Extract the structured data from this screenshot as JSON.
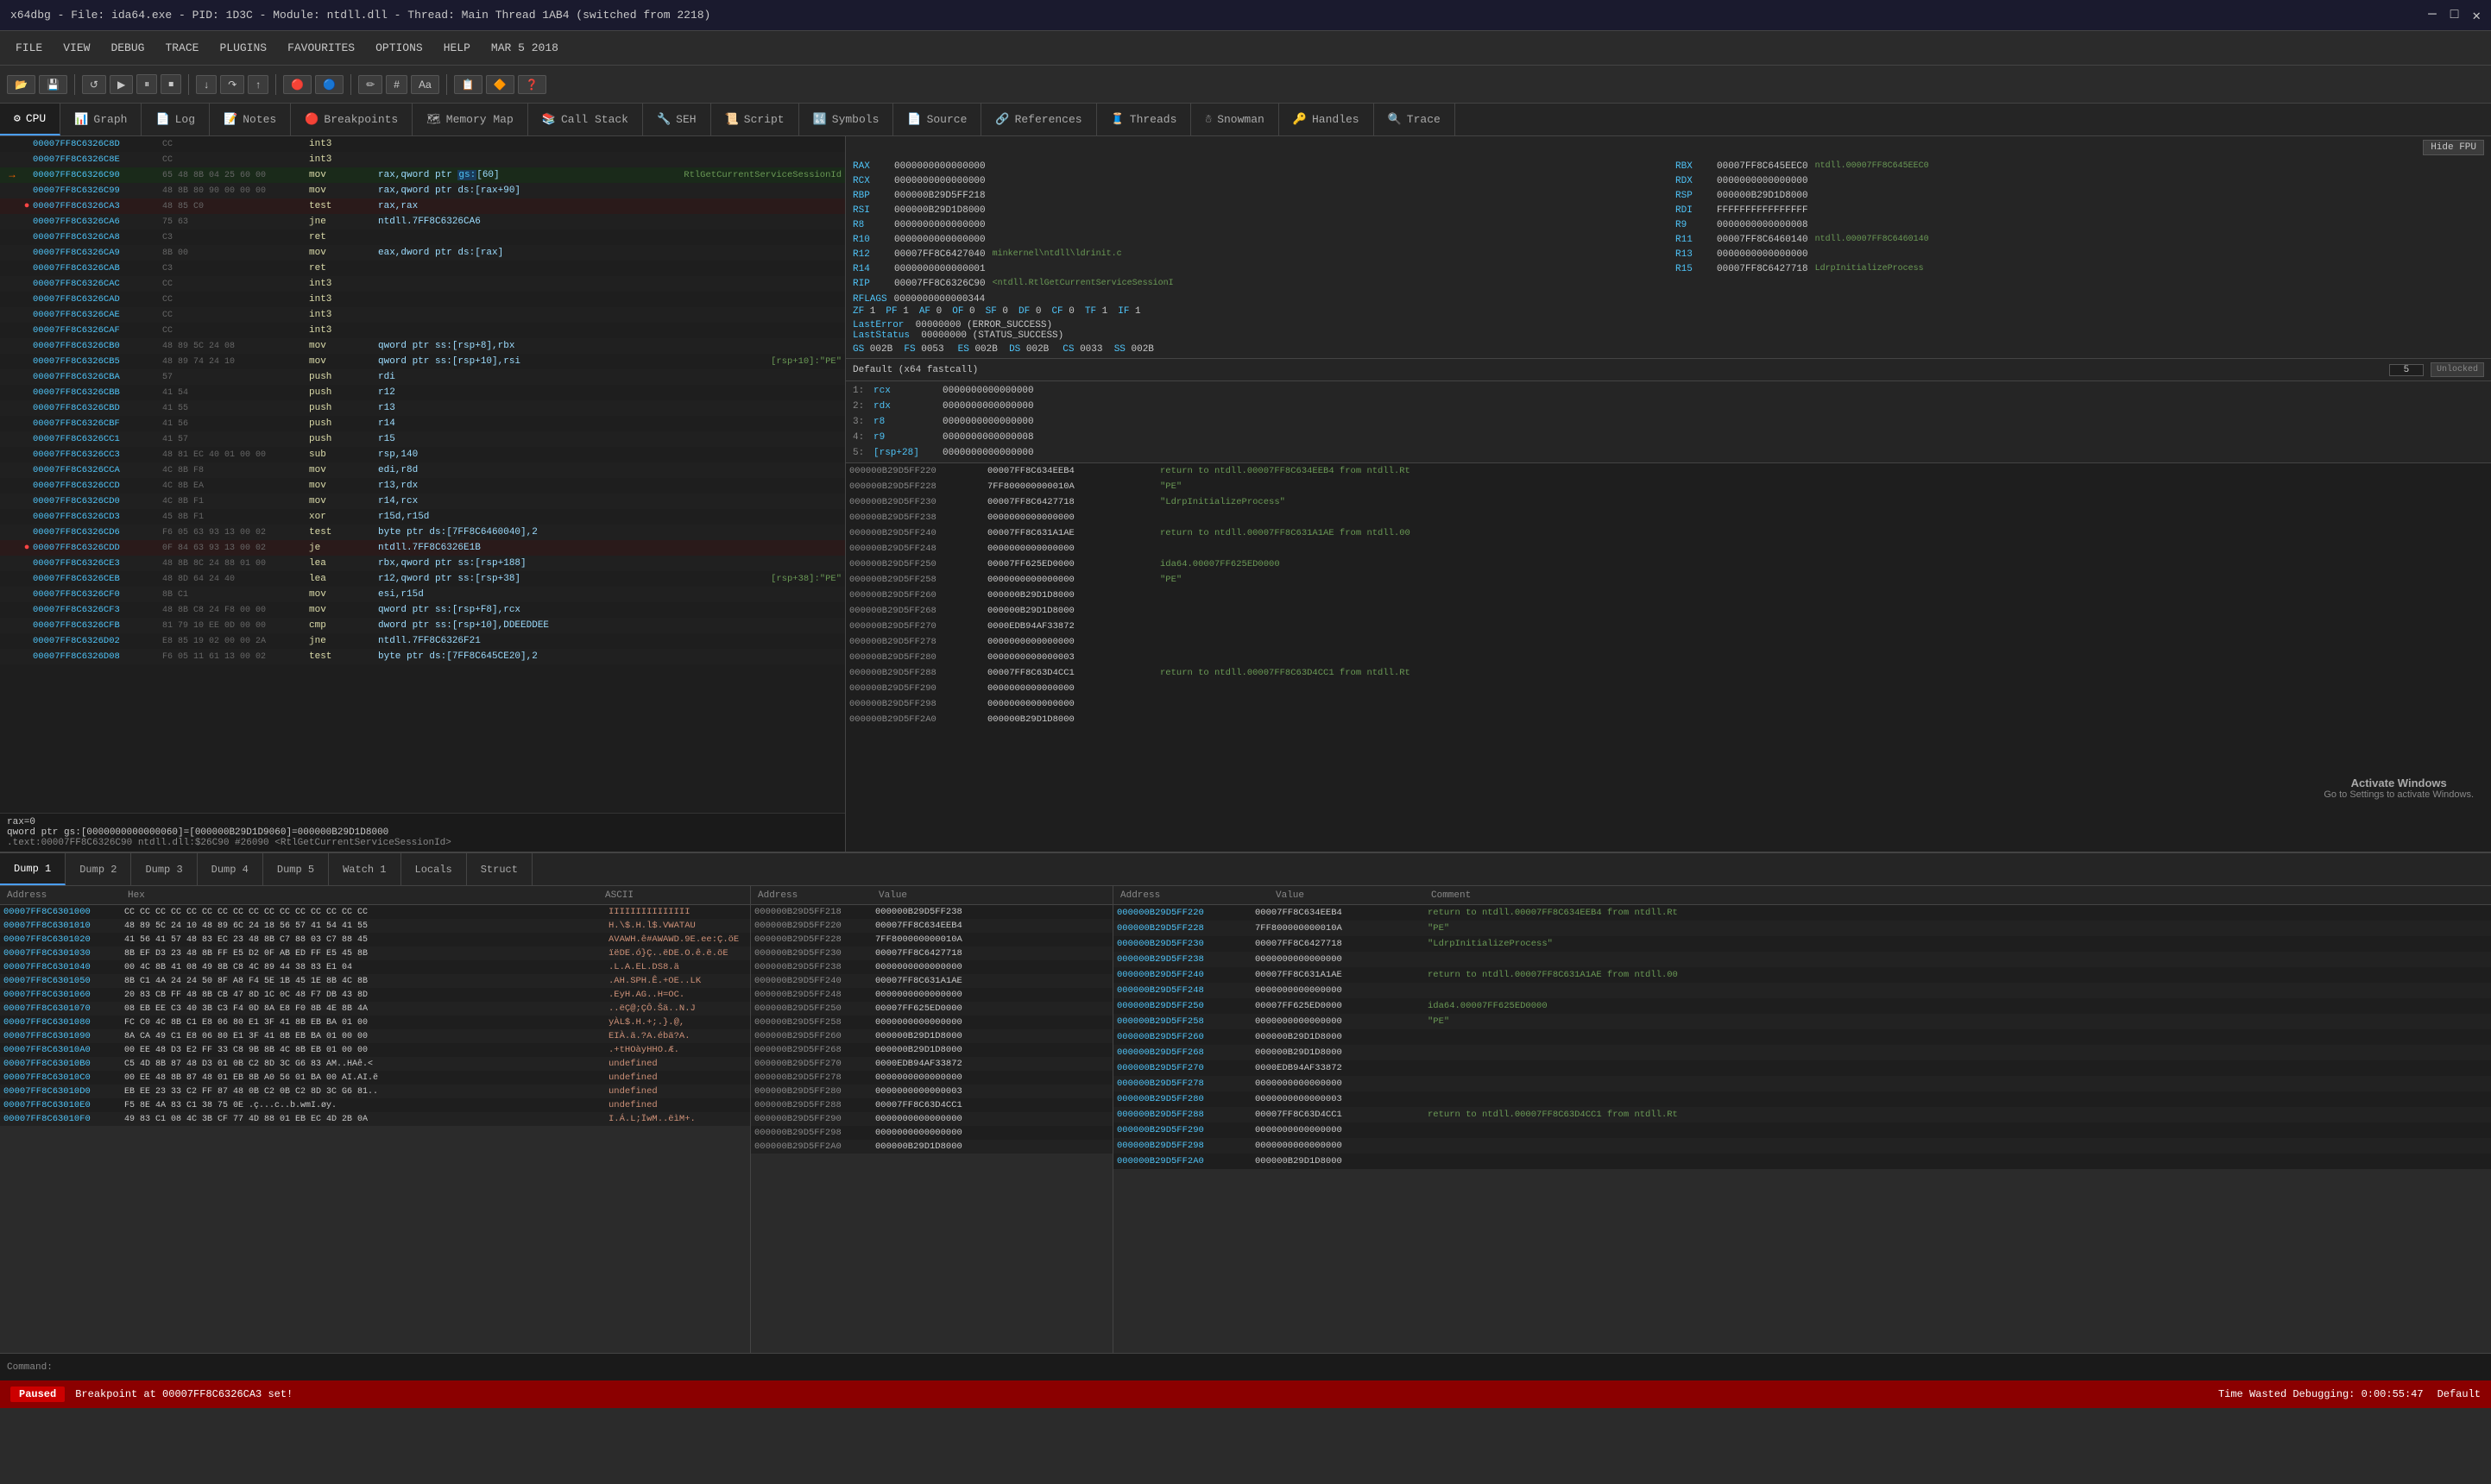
{
  "titleBar": {
    "text": "x64dbg - File: ida64.exe - PID: 1D3C - Module: ntdll.dll - Thread: Main Thread 1AB4 (switched from 2218)"
  },
  "menuBar": {
    "items": [
      "FILE",
      "VIEW",
      "DEBUG",
      "TRACE",
      "PLUGINS",
      "FAVOURITES",
      "OPTIONS",
      "HELP",
      "MAR 5 2018"
    ]
  },
  "tabs": {
    "items": [
      {
        "label": "CPU",
        "active": true
      },
      {
        "label": "Graph"
      },
      {
        "label": "Log"
      },
      {
        "label": "Notes"
      },
      {
        "label": "Breakpoints"
      },
      {
        "label": "Memory Map"
      },
      {
        "label": "Call Stack"
      },
      {
        "label": "SEH"
      },
      {
        "label": "Script"
      },
      {
        "label": "Symbols"
      },
      {
        "label": "Source"
      },
      {
        "label": "References"
      },
      {
        "label": "Threads"
      },
      {
        "label": "Snowman"
      },
      {
        "label": "Handles"
      },
      {
        "label": "Trace"
      }
    ]
  },
  "disasm": {
    "rows": [
      {
        "addr": "00007FF8C6326C8D",
        "bp": "",
        "rip": false,
        "bytes": "CC",
        "instr": "int3",
        "operands": "",
        "comment": ""
      },
      {
        "addr": "00007FF8C6326C8E",
        "bp": "",
        "rip": false,
        "bytes": "CC",
        "instr": "int3",
        "operands": "",
        "comment": ""
      },
      {
        "addr": "00007FF8C6326C90",
        "bp": "",
        "rip": true,
        "bytes": "65 48 8B 04 25 60 00",
        "instr": "mov",
        "operands": "rax,qword ptr gs:[60]",
        "comment": "RtlGetCurrentServiceSessionId"
      },
      {
        "addr": "00007FF8C6326C99",
        "bp": "",
        "rip": false,
        "bytes": "48 8B 80 90 00 00 00",
        "instr": "mov",
        "operands": "rax,qword ptr ds:[rax+90]",
        "comment": ""
      },
      {
        "addr": "00007FF8C6326CA3",
        "bp": "●",
        "rip": false,
        "bytes": "48 85 C0",
        "instr": "test",
        "operands": "rax,rax",
        "comment": ""
      },
      {
        "addr": "00007FF8C6326CA6",
        "bp": "",
        "rip": false,
        "bytes": "75 63",
        "instr": "jne",
        "operands": "ntdll.7FF8C6326CA6",
        "comment": ""
      },
      {
        "addr": "00007FF8C6326CA8",
        "bp": "",
        "rip": false,
        "bytes": "C3",
        "instr": "ret",
        "operands": "",
        "comment": ""
      },
      {
        "addr": "00007FF8C6326CA9",
        "bp": "",
        "rip": false,
        "bytes": "8B 00",
        "instr": "mov",
        "operands": "eax,dword ptr ds:[rax]",
        "comment": ""
      },
      {
        "addr": "00007FF8C6326CAB",
        "bp": "",
        "rip": false,
        "bytes": "C3",
        "instr": "ret",
        "operands": "",
        "comment": ""
      },
      {
        "addr": "00007FF8C6326CAC",
        "bp": "",
        "rip": false,
        "bytes": "CC",
        "instr": "int3",
        "operands": "",
        "comment": ""
      },
      {
        "addr": "00007FF8C6326CAD",
        "bp": "",
        "rip": false,
        "bytes": "CC",
        "instr": "int3",
        "operands": "",
        "comment": ""
      },
      {
        "addr": "00007FF8C6326CAE",
        "bp": "",
        "rip": false,
        "bytes": "CC",
        "instr": "int3",
        "operands": "",
        "comment": ""
      },
      {
        "addr": "00007FF8C6326CAF",
        "bp": "",
        "rip": false,
        "bytes": "CC",
        "instr": "int3",
        "operands": "",
        "comment": ""
      },
      {
        "addr": "00007FF8C6326CB0",
        "bp": "",
        "rip": false,
        "bytes": "48 89 5C 24 08",
        "instr": "mov",
        "operands": "qword ptr ss:[rsp+8],rbx",
        "comment": ""
      },
      {
        "addr": "00007FF8C6326CB5",
        "bp": "",
        "rip": false,
        "bytes": "48 89 74 24 10",
        "instr": "mov",
        "operands": "qword ptr ss:[rsp+10],rsi",
        "comment": "[rsp+10]:\"PE\""
      },
      {
        "addr": "00007FF8C6326CBA",
        "bp": "",
        "rip": false,
        "bytes": "57",
        "instr": "push",
        "operands": "rdi",
        "comment": ""
      },
      {
        "addr": "00007FF8C6326CBB",
        "bp": "",
        "rip": false,
        "bytes": "41 54",
        "instr": "push",
        "operands": "r12",
        "comment": ""
      },
      {
        "addr": "00007FF8C6326CBD",
        "bp": "",
        "rip": false,
        "bytes": "41 55",
        "instr": "push",
        "operands": "r13",
        "comment": ""
      },
      {
        "addr": "00007FF8C6326CBF",
        "bp": "",
        "rip": false,
        "bytes": "41 56",
        "instr": "push",
        "operands": "r14",
        "comment": ""
      },
      {
        "addr": "00007FF8C6326CC1",
        "bp": "",
        "rip": false,
        "bytes": "41 57",
        "instr": "push",
        "operands": "r15",
        "comment": ""
      },
      {
        "addr": "00007FF8C6326CC3",
        "bp": "",
        "rip": false,
        "bytes": "48 81 EC 40 01 00 00",
        "instr": "sub",
        "operands": "rsp,140",
        "comment": ""
      },
      {
        "addr": "00007FF8C6326CCA",
        "bp": "",
        "rip": false,
        "bytes": "4C 8B F8",
        "instr": "mov",
        "operands": "edi,r8d",
        "comment": ""
      },
      {
        "addr": "00007FF8C6326CCD",
        "bp": "",
        "rip": false,
        "bytes": "4C 8B EA",
        "instr": "mov",
        "operands": "r13,rdx",
        "comment": ""
      },
      {
        "addr": "00007FF8C6326CD0",
        "bp": "",
        "rip": false,
        "bytes": "4C 8B F1",
        "instr": "mov",
        "operands": "r14,rcx",
        "comment": ""
      },
      {
        "addr": "00007FF8C6326CD3",
        "bp": "",
        "rip": false,
        "bytes": "45 8B F1",
        "instr": "xor",
        "operands": "r15d,r15d",
        "comment": ""
      },
      {
        "addr": "00007FF8C6326CD6",
        "bp": "",
        "rip": false,
        "bytes": "F6 05 63 93 13 00 02",
        "instr": "test",
        "operands": "byte ptr ds:[7FF8C6460040],2",
        "comment": ""
      },
      {
        "addr": "00007FF8C6326CDD",
        "bp": "●",
        "rip": false,
        "bytes": "0F 84 63 93 13 00 02",
        "instr": "je",
        "operands": "ntdll.7FF8C6326E1B",
        "comment": ""
      },
      {
        "addr": "00007FF8C6326CE3",
        "bp": "",
        "rip": false,
        "bytes": "48 8B 8C 24 88 01 00",
        "instr": "lea",
        "operands": "rbx,qword ptr ss:[rsp+188]",
        "comment": ""
      },
      {
        "addr": "00007FF8C6326CEB",
        "bp": "",
        "rip": false,
        "bytes": "48 8D 64 24 40",
        "instr": "lea",
        "operands": "r12,qword ptr ss:[rsp+38]",
        "comment": "[rsp+38]:\"PE\""
      },
      {
        "addr": "00007FF8C6326CF0",
        "bp": "",
        "rip": false,
        "bytes": "8B C1",
        "instr": "mov",
        "operands": "esi,r15d",
        "comment": ""
      },
      {
        "addr": "00007FF8C6326CF3",
        "bp": "",
        "rip": false,
        "bytes": "48 8B C8 24 F8 00 00",
        "instr": "mov",
        "operands": "qword ptr ss:[rsp+F8],rcx",
        "comment": ""
      },
      {
        "addr": "00007FF8C6326CFB",
        "bp": "",
        "rip": false,
        "bytes": "81 79 10 EE 0D 00 00",
        "instr": "cmp",
        "operands": "dword ptr ss:[rsp+10],DDEEDDEE",
        "comment": ""
      },
      {
        "addr": "00007FF8C6326D02",
        "bp": "",
        "rip": false,
        "bytes": "E8 85 19 02 00 00 2A",
        "instr": "jne",
        "operands": "ntdll.7FF8C6326F21",
        "comment": ""
      },
      {
        "addr": "00007FF8C6326D08",
        "bp": "",
        "rip": false,
        "bytes": "F6 05 11 61 13 00 02",
        "instr": "test",
        "operands": "byte ptr ds:[7FF8C645CE20],2",
        "comment": ""
      }
    ]
  },
  "info": {
    "rax0": "rax=0",
    "qword": "qword ptr gs:[0000000000000060]=[000000B29D1D9060]=000000B29D1D8000",
    "addr": ".text:00007FF8C6326C90  ntdll.dll:$26C90  #26090  <RtlGetCurrentServiceSessionId>"
  },
  "registers": {
    "hideFpu": "Hide FPU",
    "regs": [
      {
        "name": "RAX",
        "val": "0000000000000000",
        "note": ""
      },
      {
        "name": "RBX",
        "val": "00007FF8C645EEC0",
        "note": "ntdll.00007FF8C645EEC0"
      },
      {
        "name": "RCX",
        "val": "0000000000000000",
        "note": ""
      },
      {
        "name": "RDX",
        "val": "0000000000000000",
        "note": ""
      },
      {
        "name": "RBP",
        "val": "000000B29D5FF218",
        "note": ""
      },
      {
        "name": "RSP",
        "val": "000000B29D1D8000",
        "note": ""
      },
      {
        "name": "RSI",
        "val": "000000B29D1D8000",
        "note": ""
      },
      {
        "name": "RDI",
        "val": "FFFFFFFFFFFFFFFF",
        "note": ""
      },
      {
        "name": "R8",
        "val": "0000000000000000",
        "note": ""
      },
      {
        "name": "R9",
        "val": "0000000000000008",
        "note": ""
      },
      {
        "name": "R10",
        "val": "0000000000000000",
        "note": ""
      },
      {
        "name": "R11",
        "val": "00007FF8C6460140",
        "note": "ntdll.00007FF8C6460140"
      },
      {
        "name": "R12",
        "val": "00007FF8C6427040",
        "note": "minkernel\\ntdll\\ldrinit.c"
      },
      {
        "name": "R13",
        "val": "0000000000000000",
        "note": ""
      },
      {
        "name": "R14",
        "val": "0000000000000001",
        "note": ""
      },
      {
        "name": "R15",
        "val": "00007FF8C6427718",
        "note": "LdrpInitializeProcess"
      },
      {
        "name": "RIP",
        "val": "00007FF8C6326C90",
        "note": "<ntdll.RtlGetCurrentServiceSessionI"
      }
    ],
    "rflags": "0000000000000344",
    "flags": [
      {
        "name": "ZF",
        "val": "1"
      },
      {
        "name": "PF",
        "val": "1"
      },
      {
        "name": "AF",
        "val": "0"
      },
      {
        "name": "OF",
        "val": "0"
      },
      {
        "name": "SF",
        "val": "0"
      },
      {
        "name": "DF",
        "val": "0"
      },
      {
        "name": "CF",
        "val": "0"
      },
      {
        "name": "TF",
        "val": "1"
      },
      {
        "name": "IF",
        "val": "1"
      }
    ],
    "lastError": "00000000 (ERROR_SUCCESS)",
    "lastStatus": "00000000 (STATUS_SUCCESS)",
    "segments": [
      {
        "name": "GS",
        "val": "002B",
        "name2": "FS",
        "val2": "0053"
      },
      {
        "name": "ES",
        "val": "002B",
        "name2": "DS",
        "val2": "002B"
      },
      {
        "name": "CS",
        "val": "0033",
        "name2": "SS",
        "val2": "002B"
      }
    ]
  },
  "fastcall": {
    "label": "Default (x64 fastcall)",
    "threadNum": "5",
    "unlocked": "Unlocked",
    "params": [
      {
        "num": "1:",
        "name": "rcx",
        "val": "0000000000000000"
      },
      {
        "num": "2:",
        "name": "rdx",
        "val": "0000000000000000"
      },
      {
        "num": "3:",
        "name": "r8",
        "val": "0000000000000000"
      },
      {
        "num": "4:",
        "name": "r9",
        "val": "0000000000000008"
      },
      {
        "num": "5:",
        "name": "[rsp+28]",
        "val": "0000000000000000"
      }
    ]
  },
  "callTrace": {
    "rows": [
      {
        "addr": "000000B29D5FF220",
        "val": "00007FF8C634EEB4",
        "comment": "return to ntdll.00007FF8C634EEB4 from ntdll.Rt"
      },
      {
        "addr": "000000B29D5FF228",
        "val": "7FF800000000010A",
        "comment": "\"PE\""
      },
      {
        "addr": "000000B29D5FF230",
        "val": "00007FF8C6427718",
        "comment": "\"LdrpInitializeProcess\""
      },
      {
        "addr": "000000B29D5FF238",
        "val": "0000000000000000",
        "comment": ""
      },
      {
        "addr": "000000B29D5FF240",
        "val": "00007FF8C631A1AE",
        "comment": "return to ntdll.00007FF8C631A1AE from ntdll.00"
      },
      {
        "addr": "000000B29D5FF248",
        "val": "0000000000000000",
        "comment": ""
      },
      {
        "addr": "000000B29D5FF250",
        "val": "00007FF625ED0000",
        "comment": "ida64.00007FF625ED0000"
      },
      {
        "addr": "000000B29D5FF258",
        "val": "0000000000000000",
        "comment": "\"PE\""
      },
      {
        "addr": "000000B29D5FF260",
        "val": "000000B29D1D8000",
        "comment": ""
      },
      {
        "addr": "000000B29D5FF268",
        "val": "000000B29D1D8000",
        "comment": ""
      },
      {
        "addr": "000000B29D5FF270",
        "val": "0000EDB94AF33872",
        "comment": ""
      },
      {
        "addr": "000000B29D5FF278",
        "val": "0000000000000000",
        "comment": ""
      },
      {
        "addr": "000000B29D5FF280",
        "val": "0000000000000003",
        "comment": ""
      },
      {
        "addr": "000000B29D5FF288",
        "val": "00007FF8C63D4CC1",
        "comment": "return to ntdll.00007FF8C63D4CC1 from ntdll.Rt"
      },
      {
        "addr": "000000B29D5FF290",
        "val": "0000000000000000",
        "comment": ""
      },
      {
        "addr": "000000B29D5FF298",
        "val": "0000000000000000",
        "comment": ""
      },
      {
        "addr": "000000B29D5FF2A0",
        "val": "000000B29D1D8000",
        "comment": ""
      }
    ]
  },
  "dumpTabs": [
    "Dump 1",
    "Dump 2",
    "Dump 3",
    "Dump 4",
    "Dump 5",
    "Watch 1",
    "Locals",
    "Struct"
  ],
  "dumpRows": [
    {
      "addr": "00007FF8C6301000",
      "hex": "CC CC CC CC CC CC CC CC  CC CC CC CC CC CC CC CC",
      "ascii": "IIIIIIIIIIIIIII"
    },
    {
      "addr": "00007FF8C6301010",
      "hex": "48 89 5C 24 10 48 89 6C  24 18 56 57 41 54 41 55",
      "ascii": "H.\\$.H.l$.VWATAU"
    },
    {
      "addr": "00007FF8C6301020",
      "hex": "41 56 41 57 48 83 EC 23  48 8B C7 88 03 C7 88 45",
      "ascii": "AVAWH.ê#AWAWD.9E.ee:Ç.öE"
    },
    {
      "addr": "00007FF8C6301030",
      "hex": "8B EF D3 23 48 8B FF E5  D2 0F AB ED FF E5 45 8B",
      "ascii": "ïëDE.ó}Ç..ëDE.O.ê.ë.öE"
    },
    {
      "addr": "00007FF8C6301040",
      "hex": "00 4C 8B 41 08 49 8B C8  4C 89 44 38 83 E1 04",
      "ascii": ".L.A.EL.DS8.ä"
    },
    {
      "addr": "00007FF8C6301050",
      "hex": "8B C1 4A 24 24 50 8F A8  F4 5E 1B 45 1E 8B 4C 8B",
      "ascii": ".AH.SPH.Ê.+OE..LK"
    },
    {
      "addr": "00007FF8C6301060",
      "hex": "20 83 CB FF 48 8B CB 47  8D 1C 0C 48 F7 DB 43 8D",
      "ascii": ".EyH.AG..H=OC."
    },
    {
      "addr": "00007FF8C6301070",
      "hex": "08 EB EE C3 40 3B C3 F4  0D 8A E8 F0 8B 4E 8B 4A",
      "ascii": "..ëÇ@;ÇÔ.Šä..N.J"
    },
    {
      "addr": "00007FF8C6301080",
      "hex": "FC C0 4C 8B C1 E8 06 80  E1 3F 41 8B EB BA 01 00",
      "ascii": "yÀL$.H.+;.}.@,"
    },
    {
      "addr": "00007FF8C6301090",
      "hex": "8A CA 49 C1 E8 06 80 E1  3F 41 8B EB BA 01 00 00",
      "ascii": "EIÀ.ä.?A.ébä?A."
    },
    {
      "addr": "00007FF8C63010A0",
      "hex": "00 EE 48 D3 E2 FF 33 C8  9B 8B 4C 8B EB 01 00 00",
      "ascii": ".+tHOàyHHO.Æ."
    },
    {
      "addr": "00007FF8C63010B0",
      "hex": "C5 4D 8B 87 48 D3 01 0B  C2 8D 3C G6 83 AM..HAê.<"
    },
    {
      "addr": "00007FF8C63010C0",
      "hex": "00 EE 48 8B 87 48 01 EB  8B A0 56 01 BA 00 AI.AI.ë"
    },
    {
      "addr": "00007FF8C63010D0",
      "hex": "EB EE 23 33 C2 FF 87 48  0B C2 0B C2 8D 3C G6 81.."
    },
    {
      "addr": "00007FF8C63010E0",
      "hex": "F5 8E 4A 83 C1 38 75 0E .ç...c..b.wmI.øy."
    },
    {
      "addr": "00007FF8C63010F0",
      "hex": "49 83 C1 08 4C 3B CF 77  4D 88 01 EB EC 4D 2B 0A",
      "ascii": "I.Á.L;ÏwM..ëìM+."
    }
  ],
  "stackRows": [
    {
      "addr": "000000B29D5FF218",
      "val": "000000B29D5FF238"
    },
    {
      "addr": "000000B29D5FF220",
      "val": "00007FF8C634EEB4"
    },
    {
      "addr": "000000B29D5FF228",
      "val": "7FF800000000010A"
    },
    {
      "addr": "000000B29D5FF230",
      "val": "00007FF8C6427718"
    },
    {
      "addr": "000000B29D5FF238",
      "val": "0000000000000000"
    },
    {
      "addr": "000000B29D5FF240",
      "val": "00007FF8C631A1AE"
    },
    {
      "addr": "000000B29D5FF248",
      "val": "0000000000000000"
    },
    {
      "addr": "000000B29D5FF250",
      "val": "00007FF625ED0000"
    },
    {
      "addr": "000000B29D5FF258",
      "val": "0000000000000000"
    },
    {
      "addr": "000000B29D5FF260",
      "val": "000000B29D1D8000"
    },
    {
      "addr": "000000B29D5FF268",
      "val": "000000B29D1D8000"
    },
    {
      "addr": "000000B29D5FF270",
      "val": "0000EDB94AF33872"
    },
    {
      "addr": "000000B29D5FF278",
      "val": "0000000000000000"
    },
    {
      "addr": "000000B29D5FF280",
      "val": "0000000000000003"
    },
    {
      "addr": "000000B29D5FF288",
      "val": "00007FF8C63D4CC1"
    },
    {
      "addr": "000000B29D5FF290",
      "val": "0000000000000000"
    },
    {
      "addr": "000000B29D5FF298",
      "val": "0000000000000000"
    },
    {
      "addr": "000000B29D5FF2A0",
      "val": "000000B29D1D8000"
    }
  ],
  "command": {
    "label": "Command:",
    "value": ""
  },
  "statusBar": {
    "paused": "Paused",
    "message": "Breakpoint at 00007FF8C6326CA3 set!",
    "timeLabel": "Time Wasted Debugging: 0:00:55:47",
    "defaultLabel": "Default"
  },
  "activateWindows": "Activate Windows\nGo to Settings to activate Windows."
}
